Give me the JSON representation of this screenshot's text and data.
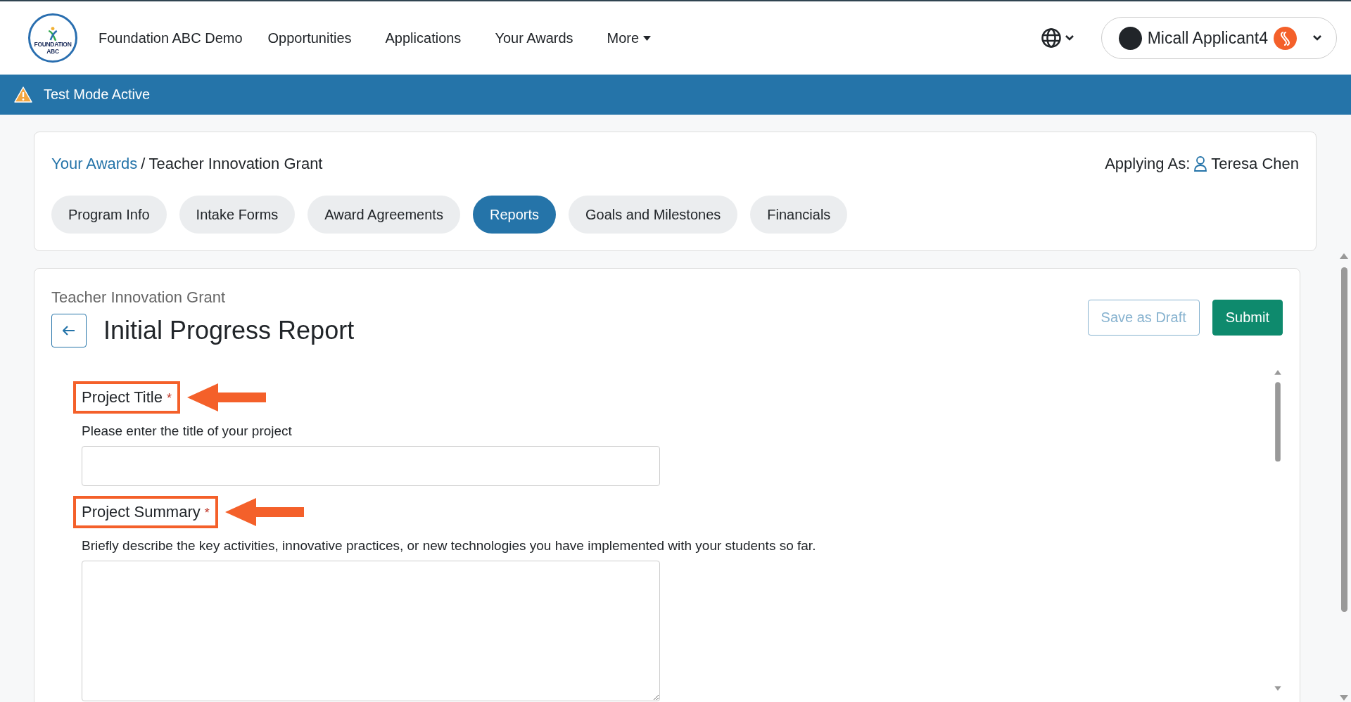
{
  "header": {
    "brand": "Foundation ABC Demo",
    "logo_text": "FOUNDATION ABC",
    "nav": [
      {
        "label": "Opportunities",
        "kind": "link"
      },
      {
        "label": "Applications",
        "kind": "link"
      },
      {
        "label": "Your Awards",
        "kind": "link"
      },
      {
        "label": "More",
        "kind": "dropdown"
      }
    ],
    "user": {
      "name": "Micall Applicant4"
    }
  },
  "banner": {
    "text": "Test Mode Active"
  },
  "breadcrumb": {
    "link": "Your Awards",
    "separator": "/",
    "current": "Teacher Innovation Grant"
  },
  "applying_as": {
    "label": "Applying As:",
    "name": "Teresa Chen"
  },
  "tabs": [
    {
      "label": "Program Info",
      "selected": false
    },
    {
      "label": "Intake Forms",
      "selected": false
    },
    {
      "label": "Award Agreements",
      "selected": false
    },
    {
      "label": "Reports",
      "selected": true
    },
    {
      "label": "Goals and Milestones",
      "selected": false
    },
    {
      "label": "Financials",
      "selected": false
    }
  ],
  "form": {
    "subtitle": "Teacher Innovation Grant",
    "title": "Initial Progress Report",
    "buttons": [
      {
        "label": "Save as Draft",
        "kind": "secondary",
        "disabled": true
      },
      {
        "label": "Submit",
        "kind": "primary",
        "disabled": false
      }
    ],
    "fields": [
      {
        "label": "Project Title",
        "required_mark": "*",
        "help": "Please enter the title of your project",
        "kind": "text",
        "annotated": true
      },
      {
        "label": "Project Summary",
        "required_mark": "*",
        "help": "Briefly describe the key activities, innovative practices, or new technologies you have implemented with your students so far.",
        "kind": "textarea",
        "annotated": true
      }
    ]
  }
}
